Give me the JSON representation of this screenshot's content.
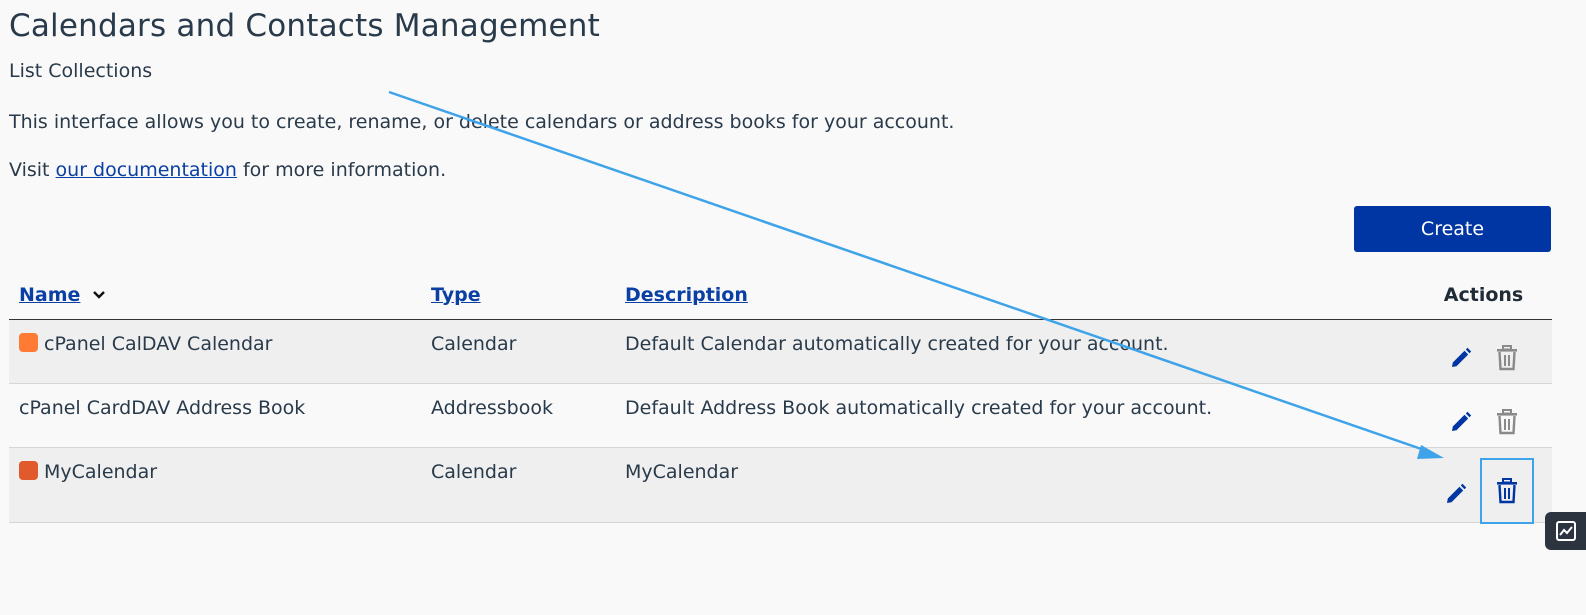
{
  "header": {
    "title": "Calendars and Contacts Management",
    "subtitle": "List Collections",
    "intro": "This interface allows you to create, rename, or delete calendars or address books for your account.",
    "visit_prefix": "Visit ",
    "doc_link": "our documentation",
    "visit_suffix": " for more information."
  },
  "toolbar": {
    "create_label": "Create"
  },
  "table": {
    "columns": {
      "name": "Name",
      "type": "Type",
      "description": "Description",
      "actions": "Actions"
    },
    "sort": {
      "column": "name",
      "direction": "descending",
      "icon": "chevron-down-icon"
    },
    "rows": [
      {
        "name": "cPanel CalDAV Calendar",
        "type": "Calendar",
        "description": "Default Calendar automatically created for your account.",
        "color": "#ff7a33",
        "has_color": true,
        "delete_enabled": false
      },
      {
        "name": "cPanel CardDAV Address Book",
        "type": "Addressbook",
        "description": "Default Address Book automatically created for your account.",
        "color": null,
        "has_color": false,
        "delete_enabled": false
      },
      {
        "name": "MyCalendar",
        "type": "Calendar",
        "description": "MyCalendar",
        "color": "#e05a2b",
        "has_color": true,
        "delete_enabled": true
      }
    ],
    "action_icons": {
      "edit": "pencil-icon",
      "delete": "trash-icon"
    }
  },
  "colors": {
    "primary": "#0036a3",
    "link": "#0a3fa3",
    "disabled_icon": "#8a8a8a",
    "annotation": "#3fa3ea"
  },
  "side_widget": {
    "icon": "chart-icon"
  }
}
